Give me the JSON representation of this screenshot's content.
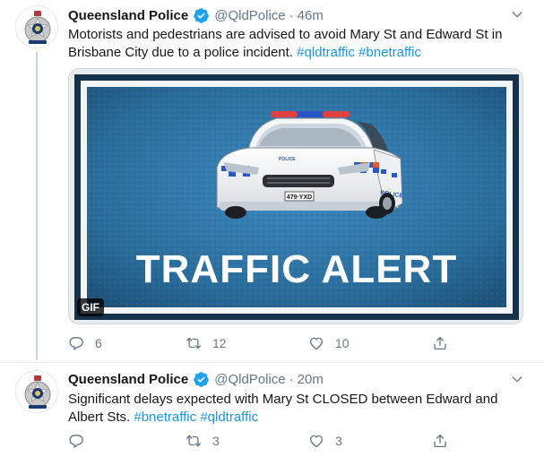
{
  "tweets": [
    {
      "display_name": "Queensland Police",
      "handle": "@QldPolice",
      "separator": "·",
      "time": "46m",
      "text_plain": "Motorists and pedestrians are advised to avoid Mary St and Edward St in Brisbane City due to a police incident. ",
      "hashtags": [
        "#qldtraffic",
        "#bnetraffic"
      ],
      "media": {
        "headline": "TRAFFIC ALERT",
        "badge": "GIF",
        "car_plate": "479·YXD",
        "car_side_text": "POLICE",
        "car_hood_text": "POLICE"
      },
      "stats": {
        "replies": "6",
        "retweets": "12",
        "likes": "10"
      }
    },
    {
      "display_name": "Queensland Police",
      "handle": "@QldPolice",
      "separator": "·",
      "time": "20m",
      "text_plain": "Significant delays expected with Mary St CLOSED between Edward and Albert Sts. ",
      "hashtags": [
        "#bnetraffic",
        "#qldtraffic"
      ],
      "stats": {
        "replies": "",
        "retweets": "3",
        "likes": "3"
      }
    }
  ],
  "icons": {
    "avatar": "queensland-police-badge",
    "verified": "verified-badge-icon",
    "more": "chevron-down-icon",
    "reply": "reply-icon",
    "retweet": "retweet-icon",
    "like": "heart-icon",
    "share": "share-icon"
  },
  "colors": {
    "hashtag": "#1b95e0",
    "verified": "#1da1f2",
    "muted": "#657786",
    "alert_background": "#2a6d9c",
    "alert_text": "#ffffff"
  }
}
